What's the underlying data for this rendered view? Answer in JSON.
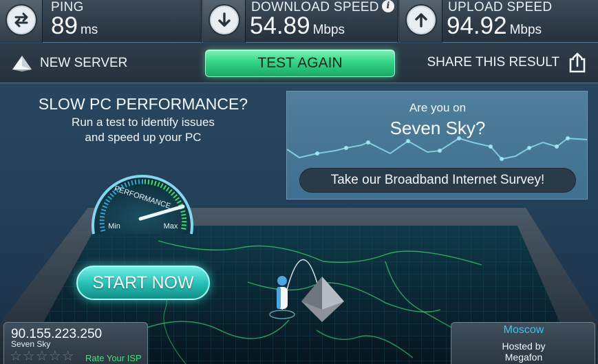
{
  "stats": {
    "ping": {
      "label": "PING",
      "value": "89",
      "unit": "ms",
      "icon": "ping-arrows-icon"
    },
    "download": {
      "label": "DOWNLOAD SPEED",
      "value": "54.89",
      "unit": "Mbps",
      "icon": "download-arrow-icon",
      "info": "i"
    },
    "upload": {
      "label": "UPLOAD SPEED",
      "value": "94.92",
      "unit": "Mbps",
      "icon": "upload-arrow-icon"
    }
  },
  "actions": {
    "new_server": "NEW SERVER",
    "test_again": "TEST AGAIN",
    "share": "SHARE THIS RESULT"
  },
  "promo": {
    "title": "SLOW PC PERFORMANCE?",
    "line1": "Run a test to identify issues",
    "line2": "and speed up your PC",
    "gauge_label": "PERFORMANCE",
    "gauge_min": "Min",
    "gauge_max": "Max",
    "start_now": "START NOW"
  },
  "survey": {
    "question": "Are you on",
    "isp": "Seven Sky?",
    "button": "Take our Broadband Internet Survey!"
  },
  "client": {
    "ip": "90.155.223.250",
    "isp": "Seven Sky",
    "rate_label": "Rate Your ISP",
    "stars_total": 5,
    "stars_filled": 0
  },
  "server": {
    "city": "Moscow",
    "hosted_by": "Hosted by",
    "host": "Megafon"
  },
  "colors": {
    "accent_green": "#37d98b",
    "accent_cyan": "#25bdb3",
    "city_blue": "#36c6f0",
    "rate_green": "#49e07a"
  }
}
